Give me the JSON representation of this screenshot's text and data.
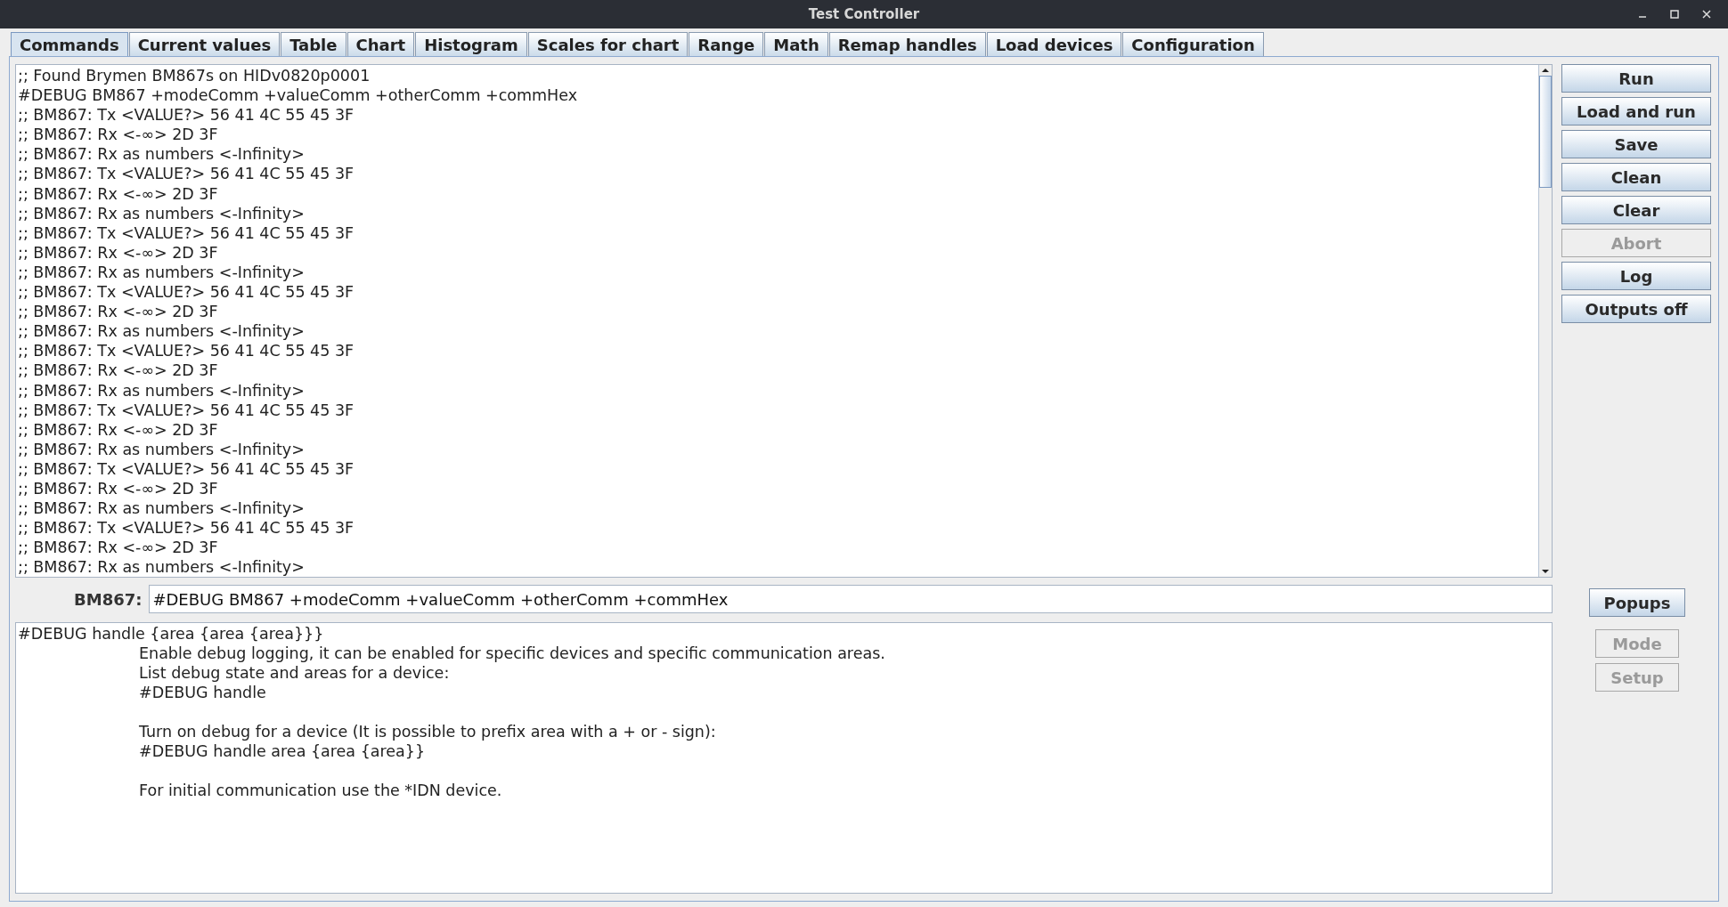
{
  "window": {
    "title": "Test Controller"
  },
  "tabs": [
    {
      "label": "Commands",
      "selected": true
    },
    {
      "label": "Current values",
      "selected": false
    },
    {
      "label": "Table",
      "selected": false
    },
    {
      "label": "Chart",
      "selected": false
    },
    {
      "label": "Histogram",
      "selected": false
    },
    {
      "label": "Scales for chart",
      "selected": false
    },
    {
      "label": "Range",
      "selected": false
    },
    {
      "label": "Math",
      "selected": false
    },
    {
      "label": "Remap handles",
      "selected": false
    },
    {
      "label": "Load devices",
      "selected": false
    },
    {
      "label": "Configuration",
      "selected": false
    }
  ],
  "log": [
    ";; Found Brymen BM867s on HIDv0820p0001",
    "#DEBUG BM867 +modeComm +valueComm +otherComm +commHex",
    ";; BM867: Tx <VALUE?> 56 41 4C 55 45 3F",
    ";; BM867: Rx <-∞> 2D 3F",
    ";; BM867: Rx as numbers <-Infinity>",
    ";; BM867: Tx <VALUE?> 56 41 4C 55 45 3F",
    ";; BM867: Rx <-∞> 2D 3F",
    ";; BM867: Rx as numbers <-Infinity>",
    ";; BM867: Tx <VALUE?> 56 41 4C 55 45 3F",
    ";; BM867: Rx <-∞> 2D 3F",
    ";; BM867: Rx as numbers <-Infinity>",
    ";; BM867: Tx <VALUE?> 56 41 4C 55 45 3F",
    ";; BM867: Rx <-∞> 2D 3F",
    ";; BM867: Rx as numbers <-Infinity>",
    ";; BM867: Tx <VALUE?> 56 41 4C 55 45 3F",
    ";; BM867: Rx <-∞> 2D 3F",
    ";; BM867: Rx as numbers <-Infinity>",
    ";; BM867: Tx <VALUE?> 56 41 4C 55 45 3F",
    ";; BM867: Rx <-∞> 2D 3F",
    ";; BM867: Rx as numbers <-Infinity>",
    ";; BM867: Tx <VALUE?> 56 41 4C 55 45 3F",
    ";; BM867: Rx <-∞> 2D 3F",
    ";; BM867: Rx as numbers <-Infinity>",
    ";; BM867: Tx <VALUE?> 56 41 4C 55 45 3F",
    ";; BM867: Rx <-∞> 2D 3F",
    ";; BM867: Rx as numbers <-Infinity>"
  ],
  "buttons": [
    {
      "label": "Run",
      "disabled": false
    },
    {
      "label": "Load and run",
      "disabled": false
    },
    {
      "label": "Save",
      "disabled": false
    },
    {
      "label": "Clean",
      "disabled": false
    },
    {
      "label": "Clear",
      "disabled": false
    },
    {
      "label": "Abort",
      "disabled": true
    },
    {
      "label": "Log",
      "disabled": false
    },
    {
      "label": "Outputs off",
      "disabled": false
    }
  ],
  "command": {
    "label": "BM867:",
    "value": "#DEBUG BM867 +modeComm +valueComm +otherComm +commHex"
  },
  "device_buttons": [
    {
      "label": "Popups",
      "disabled": false
    },
    {
      "label": "Mode",
      "disabled": true
    },
    {
      "label": "Setup",
      "disabled": true
    }
  ],
  "help": {
    "syntax": "#DEBUG handle {area {area {area}}}",
    "paragraphs": [
      [
        "Enable debug logging, it can be enabled for specific devices and specific communication areas.",
        "List debug state and areas for a device:",
        "#DEBUG handle"
      ],
      [
        "Turn on debug for a device (It is possible to prefix area with a + or - sign):",
        "#DEBUG handle area {area {area}}"
      ],
      [
        "For initial communication use the *IDN device."
      ]
    ]
  }
}
